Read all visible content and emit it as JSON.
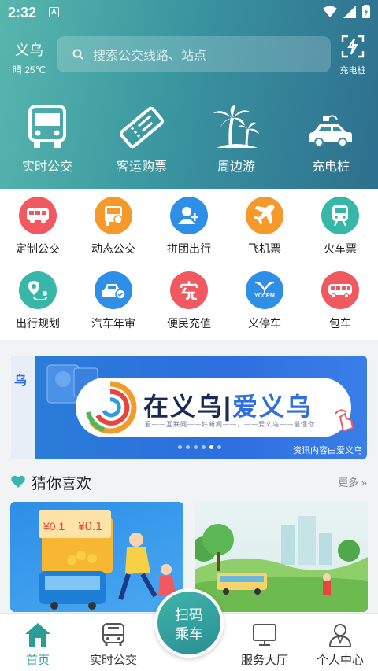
{
  "status_bar": {
    "time": "2:32",
    "badge": "A"
  },
  "header": {
    "city": "义乌",
    "weather": "晴 25℃",
    "search_placeholder": "搜索公交线路、站点",
    "charge_label": "充电桩"
  },
  "main_services": [
    {
      "label": "实时公交",
      "icon": "bus-icon"
    },
    {
      "label": "客运购票",
      "icon": "ticket-icon"
    },
    {
      "label": "周边游",
      "icon": "palm-tree-icon"
    },
    {
      "label": "充电桩",
      "icon": "electric-car-icon"
    }
  ],
  "grid": [
    {
      "label": "定制公交",
      "icon": "custom-bus-icon",
      "color": "#f2585f"
    },
    {
      "label": "动态公交",
      "icon": "dynamic-bus-icon",
      "color": "#f59a2a"
    },
    {
      "label": "拼团出行",
      "icon": "group-travel-icon",
      "color": "#2f8fe6"
    },
    {
      "label": "飞机票",
      "icon": "airplane-icon",
      "color": "#f59a2a"
    },
    {
      "label": "火车票",
      "icon": "train-icon",
      "color": "#37b7a8"
    },
    {
      "label": "出行规划",
      "icon": "route-plan-icon",
      "color": "#37b7a8"
    },
    {
      "label": "汽车年审",
      "icon": "car-inspection-icon",
      "color": "#2f8fe6"
    },
    {
      "label": "便民充值",
      "icon": "recharge-icon",
      "color": "#f2585f"
    },
    {
      "label": "义停车",
      "icon": "parking-logo-icon",
      "color": "#2f8fe6",
      "logo_text": "YCCRM"
    },
    {
      "label": "包车",
      "icon": "charter-bus-icon",
      "color": "#f2585f"
    }
  ],
  "banner": {
    "title_main": "在义乌",
    "title_accent": "爱义乌",
    "subtitle": "看——互联网——好新闻——，——爱义乌——最懂你",
    "credit": "资讯内容由爱义乌",
    "side_text": "乌",
    "slides": 6,
    "active_slide": 5
  },
  "recommend": {
    "title": "猜你喜欢",
    "more": "更多",
    "card1_tag1": "¥0.1",
    "card1_tag2": "¥0.1"
  },
  "scan_button": {
    "line1": "扫码",
    "line2": "乘车"
  },
  "tabbar": [
    {
      "label": "首页",
      "icon": "home-icon",
      "active": true
    },
    {
      "label": "实时公交",
      "icon": "bus-outline-icon",
      "active": false
    },
    {
      "label": "",
      "icon": "",
      "active": false
    },
    {
      "label": "服务大厅",
      "icon": "monitor-icon",
      "active": false
    },
    {
      "label": "个人中心",
      "icon": "user-icon",
      "active": false
    }
  ],
  "colors": {
    "accent": "#2a9d94",
    "header_start": "#57b7ad",
    "header_end": "#2e6f8f"
  }
}
